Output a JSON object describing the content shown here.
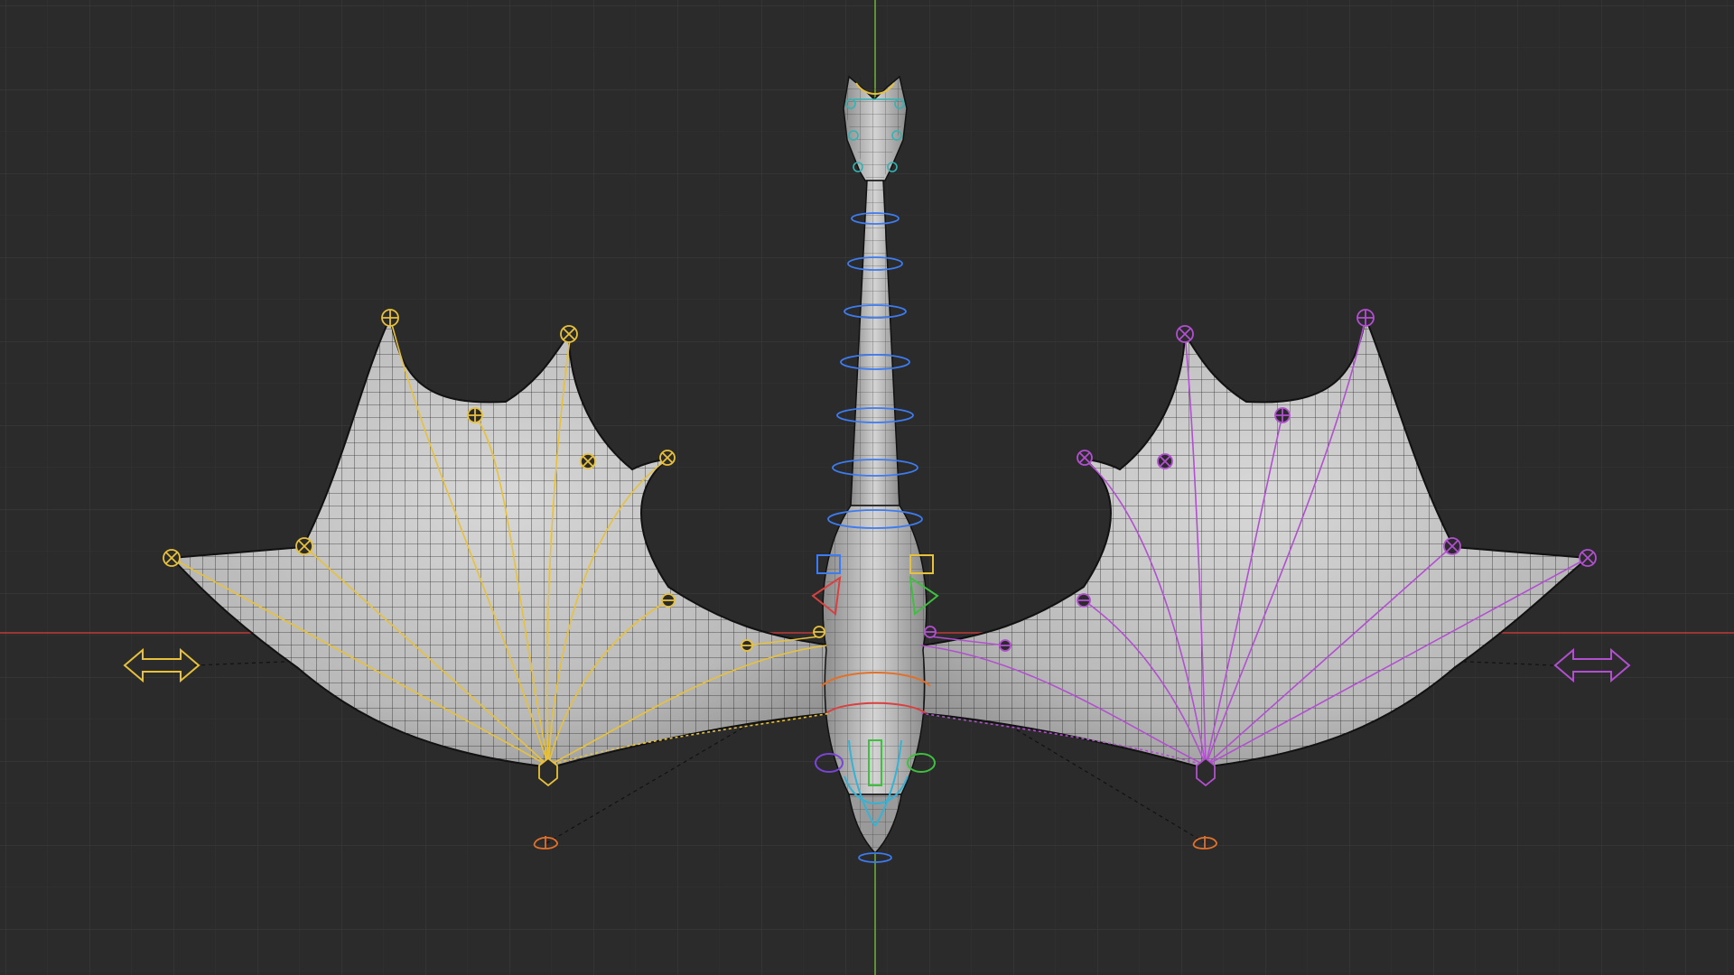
{
  "viewport": {
    "view": "top-orthographic",
    "background_color": "#2b2b2b",
    "grid_color": "#3a3a3a",
    "x_axis_color": "#c0393b",
    "y_axis_color": "#6fa83a"
  },
  "model": {
    "mesh_color": "#bdbdbd",
    "wire_color": "#111111"
  },
  "rig": {
    "left_side_color": "#e8c13a",
    "right_side_color": "#b24fd0",
    "spine_color": "#3d7bf0",
    "foot_control_color": "#e0702a",
    "left_wing_control_icon": "double-arrow-icon",
    "right_wing_control_icon": "double-arrow-icon",
    "foot_control_icon": "foot-target-icon"
  }
}
